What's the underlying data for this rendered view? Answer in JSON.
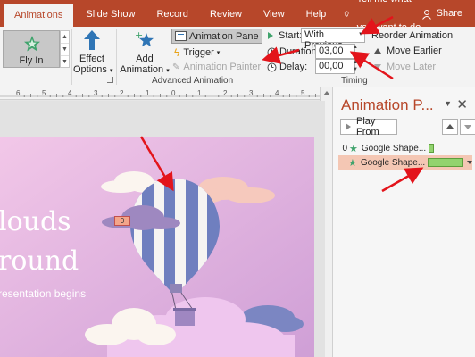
{
  "tabs": [
    {
      "label": "Animations",
      "active": true
    },
    {
      "label": "Slide Show"
    },
    {
      "label": "Record"
    },
    {
      "label": "Review"
    },
    {
      "label": "View"
    },
    {
      "label": "Help"
    }
  ],
  "tell_me": "Tell me what you want to do",
  "share": "Share",
  "ribbon": {
    "gallery_selected": "Fly In",
    "effect_options": {
      "line1": "Effect",
      "line2": "Options"
    },
    "add_animation": {
      "line1": "Add",
      "line2": "Animation"
    },
    "animation_pane": "Animation Pane",
    "trigger": "Trigger",
    "animation_painter": "Animation Painter",
    "advanced_group": "Advanced Animation",
    "start_label": "Start:",
    "start_value": "With Previous",
    "duration_label": "Duration:",
    "duration_value": "03,00",
    "delay_label": "Delay:",
    "delay_value": "00,00",
    "reorder": "Reorder Animation",
    "move_earlier": "Move Earlier",
    "move_later": "Move Later",
    "timing_group": "Timing"
  },
  "ruler": {
    "labels": [
      "6",
      "5",
      "4",
      "3",
      "2",
      "1",
      "0",
      "1",
      "2",
      "3",
      "4",
      "5",
      "6"
    ]
  },
  "slide": {
    "title_line1": "louds",
    "title_line2": "round",
    "subtitle": "resentation begins",
    "badge": "0"
  },
  "pane": {
    "title": "Animation P...",
    "play_from": "Play From",
    "items": [
      {
        "num": "0",
        "name": "Google Shape...",
        "bar": 0.14,
        "selected": false
      },
      {
        "num": "",
        "name": "Google Shape...",
        "bar": 1.0,
        "selected": true
      }
    ]
  },
  "colors": {
    "accent": "#b7472a",
    "bar_fill": "#92d36e",
    "selection": "#f4c7b4",
    "arrow": "#e3141b"
  }
}
